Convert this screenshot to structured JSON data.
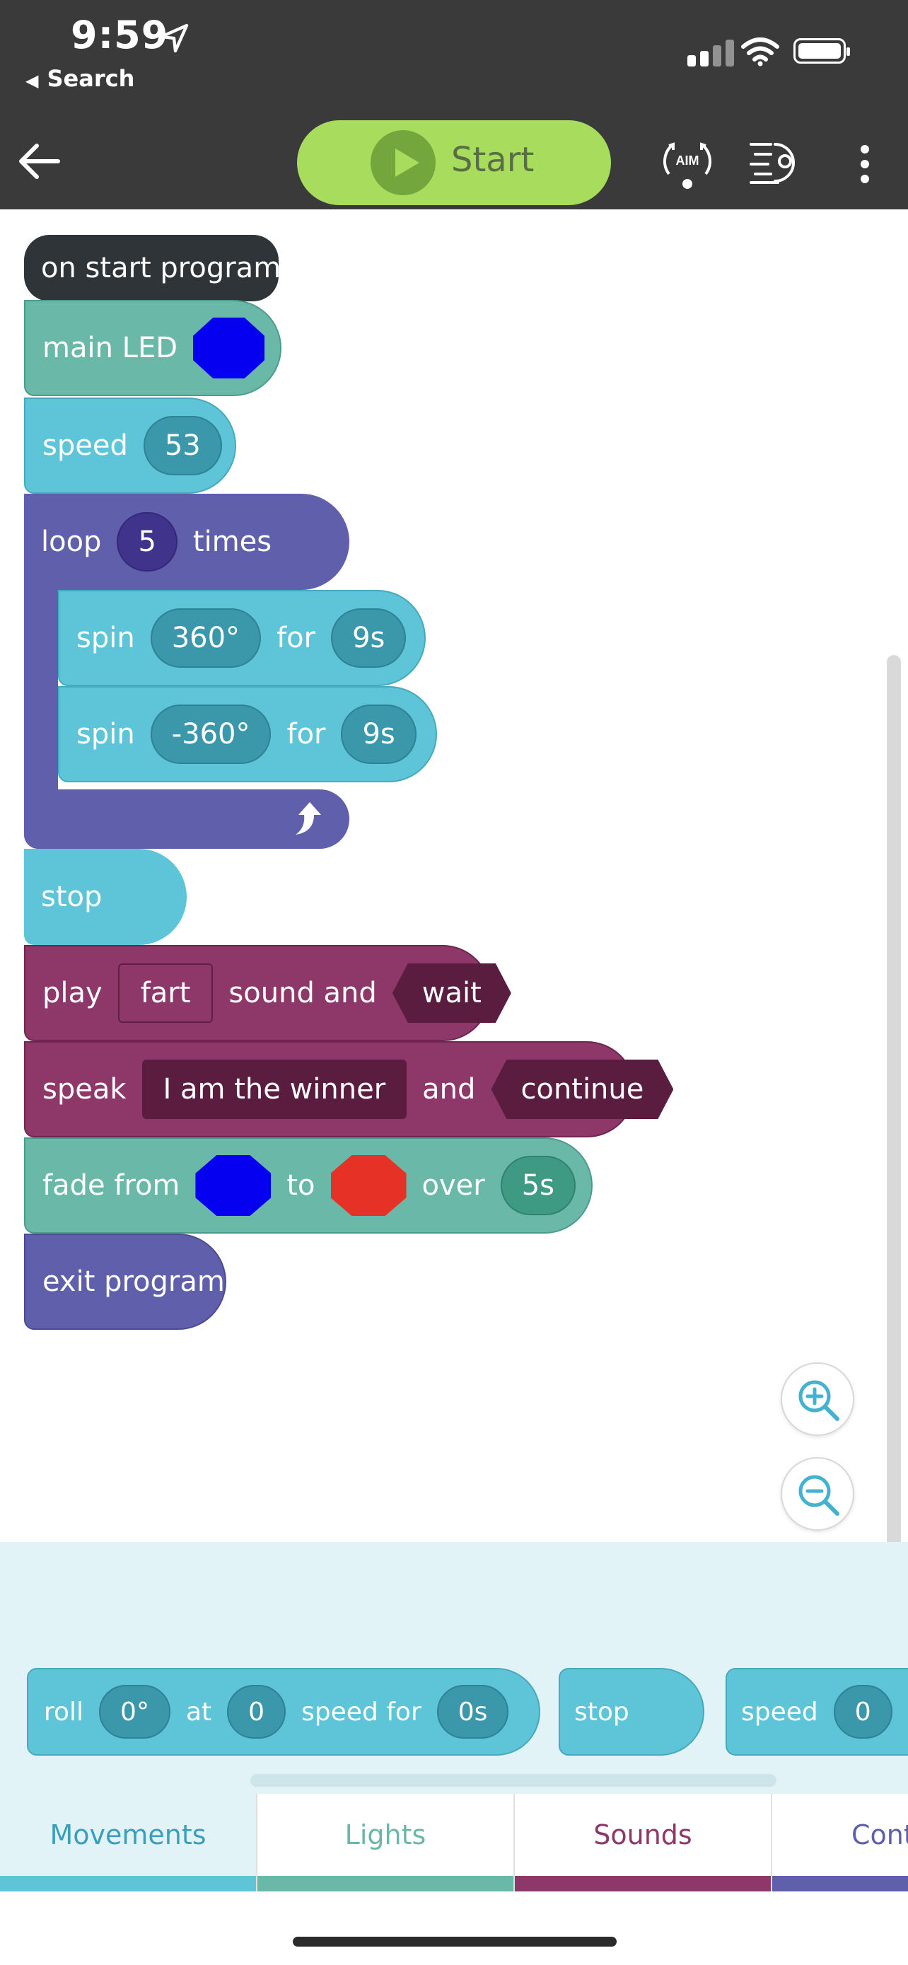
{
  "status": {
    "time": "9:59",
    "back_app": "Search"
  },
  "toolbar": {
    "start_label": "Start",
    "aim_label": "AIM"
  },
  "colors": {
    "start": "#a8dc5d",
    "control": "#5f5fab",
    "movement": "#5ec4d8",
    "light": "#6ab8a8",
    "sound": "#8e3769",
    "event": "#2f3438",
    "pill_dark": "#3b97aa",
    "led_blue": "#0500f0",
    "led_red": "#e63226"
  },
  "program": {
    "on_start": "on start program",
    "main_led": {
      "label": "main LED",
      "color": "#0500f0"
    },
    "speed": {
      "label": "speed",
      "value": "53"
    },
    "loop": {
      "label": "loop",
      "count": "5",
      "suffix": "times"
    },
    "spin1": {
      "label": "spin",
      "angle": "360°",
      "for": "for",
      "duration": "9s"
    },
    "spin2": {
      "label": "spin",
      "angle": "-360°",
      "for": "for",
      "duration": "9s"
    },
    "stop": "stop",
    "play": {
      "label": "play",
      "sound": "fart",
      "middle": "sound and",
      "mode": "wait"
    },
    "speak": {
      "label": "speak",
      "text": "I am the winner",
      "middle": "and",
      "mode": "continue"
    },
    "fade": {
      "label": "fade from",
      "from_color": "#0500f0",
      "to": "to",
      "to_color": "#e63226",
      "over": "over",
      "duration": "5s"
    },
    "exit": "exit program"
  },
  "palette": {
    "roll": {
      "label": "roll",
      "angle": "0°",
      "at": "at",
      "speed": "0",
      "speed_for": "speed for",
      "duration": "0s"
    },
    "stop": "stop",
    "speed": {
      "label": "speed",
      "value": "0"
    }
  },
  "tabs": [
    {
      "label": "Movements",
      "color": "#5ec4d8"
    },
    {
      "label": "Lights",
      "color": "#6ab8a8"
    },
    {
      "label": "Sounds",
      "color": "#8e3769"
    },
    {
      "label": "Cont",
      "color": "#5f5fab"
    }
  ]
}
